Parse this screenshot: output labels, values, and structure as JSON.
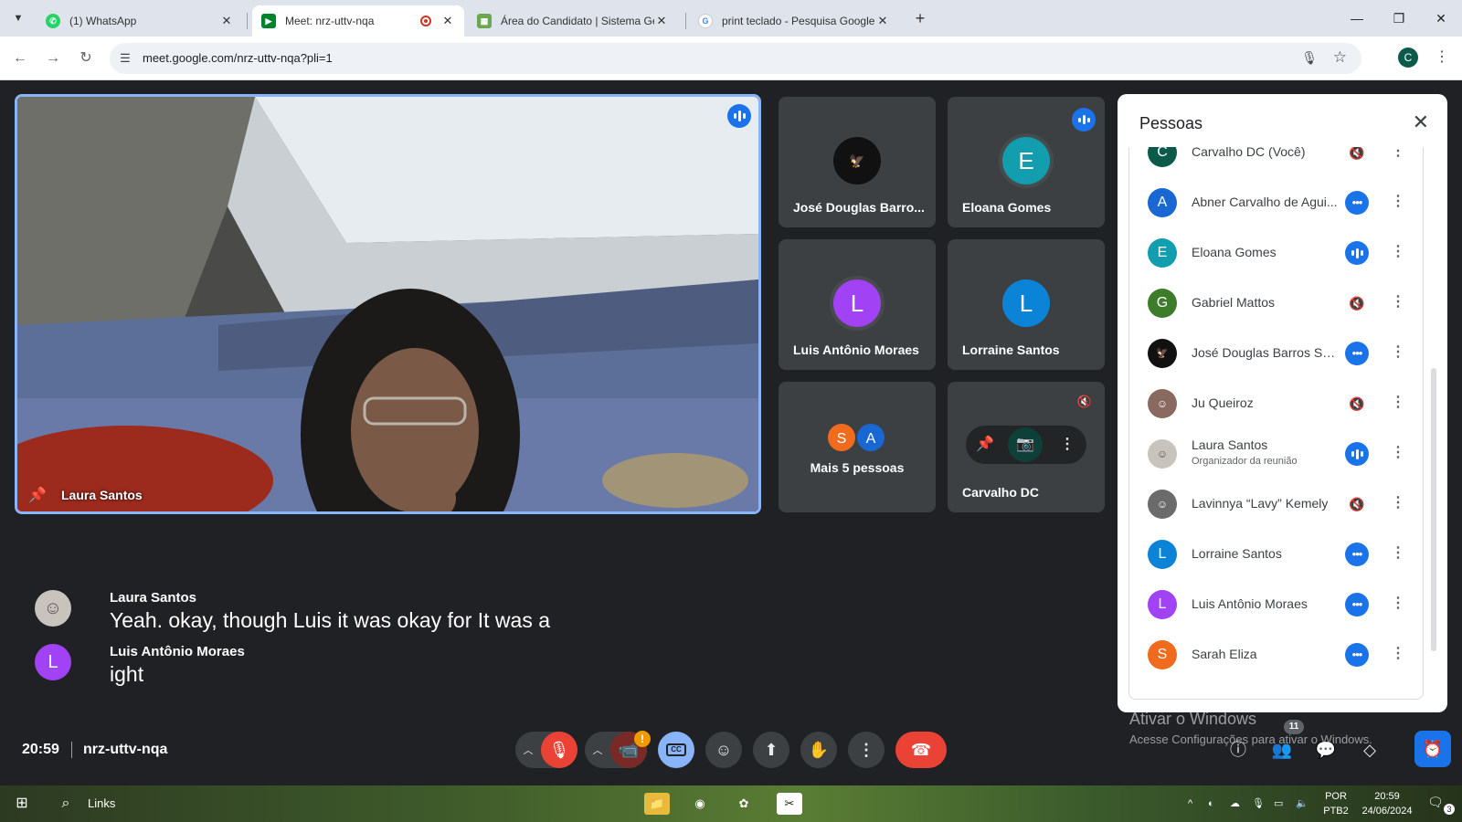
{
  "browser": {
    "tabs": [
      {
        "title": "(1) WhatsApp",
        "icon": "whatsapp-icon",
        "active": false
      },
      {
        "title": "Meet: nrz-uttv-nqa",
        "icon": "google-meet-icon",
        "active": true
      },
      {
        "title": "Área do Candidato | Sistema Ge",
        "icon": "site-icon",
        "active": false
      },
      {
        "title": "print teclado - Pesquisa Google",
        "icon": "google-icon",
        "active": false
      }
    ],
    "url": "meet.google.com/nrz-uttv-nqa?pli=1",
    "profile_initial": "C"
  },
  "main_tile": {
    "name": "Laura Santos",
    "speaking": true
  },
  "tiles": [
    {
      "name": "José Douglas Barro...",
      "type": "photo",
      "speaking": false
    },
    {
      "name": "Eloana Gomes",
      "initial": "E",
      "color": "#129eaf",
      "speaking": true
    },
    {
      "name": "Luis Antônio Moraes",
      "initial": "L",
      "color": "#a142f4",
      "speaking": false
    },
    {
      "name": "Lorraine Santos",
      "initial": "L",
      "color": "#0b84d8",
      "speaking": false
    },
    {
      "more_label": "Mais 5 pessoas",
      "initials": [
        "S",
        "A"
      ],
      "colors": [
        "#f06b1e",
        "#1967d2"
      ]
    },
    {
      "name": "Carvalho DC",
      "self": true,
      "muted": true
    }
  ],
  "captions": [
    {
      "speaker": "Laura Santos",
      "text": "Yeah. okay, though Luis it was okay for It was a",
      "avatar": "photo"
    },
    {
      "speaker": "Luis Antônio Moraes",
      "text": "ight",
      "initial": "L",
      "color": "#a142f4"
    }
  ],
  "bottom": {
    "time": "20:59",
    "meeting_code": "nrz-uttv-nqa",
    "people_count": "11",
    "alert_badge": "!"
  },
  "people_panel": {
    "title": "Pessoas",
    "participants": [
      {
        "name": "Carvalho DC (Você)",
        "initial": "C",
        "color": "#0b5a4c",
        "status": "muted"
      },
      {
        "name": "Abner Carvalho de Agui...",
        "initial": "A",
        "color": "#1967d2",
        "status": "dots"
      },
      {
        "name": "Eloana Gomes",
        "initial": "E",
        "color": "#129eaf",
        "status": "speaking"
      },
      {
        "name": "Gabriel Mattos",
        "initial": "G",
        "color": "#3d7c2a",
        "status": "muted"
      },
      {
        "name": "José Douglas Barros Silva",
        "initial": "",
        "color": "#111111",
        "status": "dots"
      },
      {
        "name": "Ju Queiroz",
        "initial": "",
        "color": "#8a6a60",
        "status": "muted"
      },
      {
        "name": "Laura Santos",
        "subtitle": "Organizador da reunião",
        "initial": "",
        "color": "#9e9e9e",
        "status": "speaking"
      },
      {
        "name": "Lavinnya “Lavy” Kemely",
        "initial": "",
        "color": "#6b6b6b",
        "status": "muted"
      },
      {
        "name": "Lorraine Santos",
        "initial": "L",
        "color": "#0b84d8",
        "status": "dots"
      },
      {
        "name": "Luis Antônio Moraes",
        "initial": "L",
        "color": "#a142f4",
        "status": "dots"
      },
      {
        "name": "Sarah Eliza",
        "initial": "S",
        "color": "#f06b1e",
        "status": "dots"
      }
    ]
  },
  "watermark": {
    "line1": "Ativar o Windows",
    "line2": "Acesse Configurações para ativar o Windows."
  },
  "taskbar": {
    "links_label": "Links",
    "lang_line1": "POR",
    "lang_line2": "PTB2",
    "clock_time": "20:59",
    "clock_date": "24/06/2024",
    "notification_count": "3"
  }
}
